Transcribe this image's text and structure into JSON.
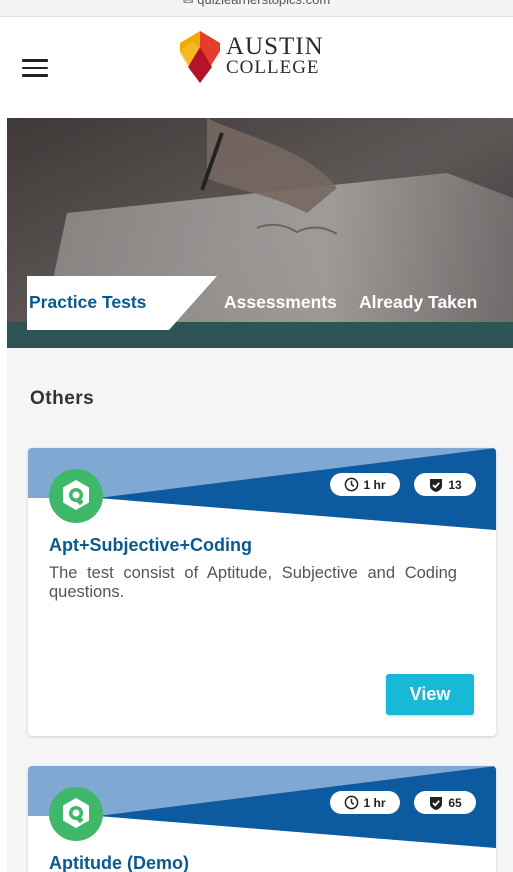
{
  "browser": {
    "url_text": "✉ quizlearnerstopics.com"
  },
  "header": {
    "menu_icon": "hamburger-menu-icon",
    "logo": {
      "line1": "AUSTIN",
      "line2": "COLLEGE",
      "colors": [
        "#f2a900",
        "#e53c2e",
        "#b4132a"
      ]
    }
  },
  "tabs": [
    {
      "label": "Practice Tests",
      "active": true
    },
    {
      "label": "Assessments",
      "active": false
    },
    {
      "label": "Already Taken",
      "active": false
    }
  ],
  "section": {
    "title": "Others"
  },
  "tests": [
    {
      "title": "Apt+Subjective+Coding",
      "description": "The test consist of Aptitude, Subjective and Coding questions.",
      "duration": "1 hr",
      "questions": "13",
      "button_label": "View"
    },
    {
      "title": "Aptitude (Demo)",
      "duration": "1 hr",
      "questions": "65"
    }
  ],
  "colors": {
    "brand_blue": "#0b5a8f",
    "banner_light": "#7fa9d2",
    "banner_dark": "#0c5aa0",
    "view_button": "#17b9d6",
    "quiz_logo_green": "#3fb86a",
    "tab_strip": "#2f5458"
  }
}
